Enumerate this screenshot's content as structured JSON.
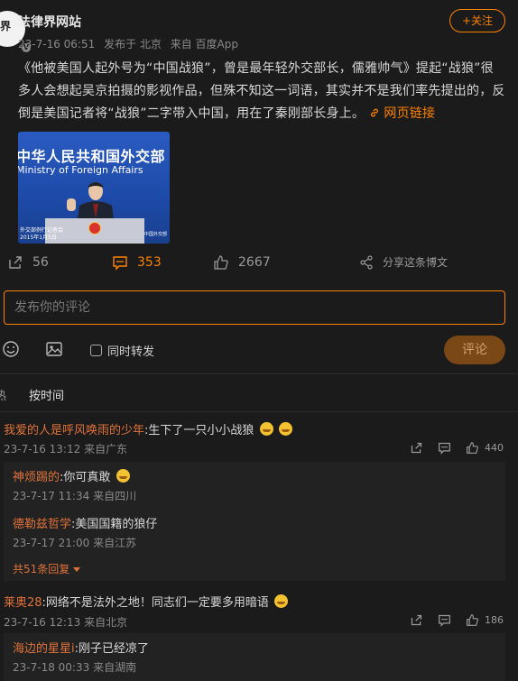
{
  "post": {
    "author": "法律界网站",
    "avatar_text": "界",
    "time": "23-7-16 06:51",
    "location": "发布于 北京",
    "source": "来自 百度App",
    "follow_label": "+关注",
    "text": "《他被美国人起外号为“中国战狼”，曾是最年轻外交部长，儒雅帅气》提起“战狼”很多人会想起吴京拍摄的影视作品，但殊不知这一词语，其实并不是我们率先提出的，反倒是美国记者将“战狼”二字带入中国，用在了秦刚部长身上。",
    "link_label": "网页链接",
    "image": {
      "text_line1": "中华人民共和国外交部",
      "text_line2": "Ministry of Foreign Affairs",
      "caption1": "外交部例行记者会",
      "caption2": "2015年1月5日",
      "caption3": "中国外交部"
    }
  },
  "actions": {
    "repost_count": "56",
    "comment_count": "353",
    "like_count": "2667",
    "share_label": "分享这条博文"
  },
  "composer": {
    "placeholder": "发布你的评论",
    "also_repost_label": "同时转发",
    "submit_label": "评论"
  },
  "sort": {
    "cut_label": "热",
    "time_label": "按时间"
  },
  "comments": [
    {
      "name": "我爱的人是呼风唤雨的少年",
      "text": ":生下了一只小小战狼",
      "time": "23-7-16 13:12",
      "source": "来自广东",
      "likes": "440",
      "replies": [
        {
          "name": "神烦踢的",
          "text": ":你可真敢",
          "time": "23-7-17 11:34",
          "source": "来自四川"
        },
        {
          "name": "德勒兹哲学",
          "text": ":美国国籍的狼仔",
          "time": "23-7-17 21:00",
          "source": "来自江苏"
        }
      ],
      "more_replies": "共51条回复"
    },
    {
      "name": "莱奥28",
      "text": ":网络不是法外之地！同志们一定要多用暗语",
      "time": "23-7-16 12:13",
      "source": "来自北京",
      "likes": "186",
      "replies": [
        {
          "name": "海边的星星i",
          "text": ":刚子已经凉了",
          "time": "23-7-18 00:33",
          "source": "来自湖南"
        }
      ]
    }
  ],
  "colors": {
    "background": "#1b1b1b",
    "accent": "#ff8200",
    "username": "#e0733a",
    "muted": "#8a8a8a"
  },
  "icons": [
    "repost-icon",
    "comment-icon",
    "like-icon",
    "share-icon",
    "emoji-icon",
    "image-icon",
    "link-icon",
    "chevron-down-icon"
  ]
}
